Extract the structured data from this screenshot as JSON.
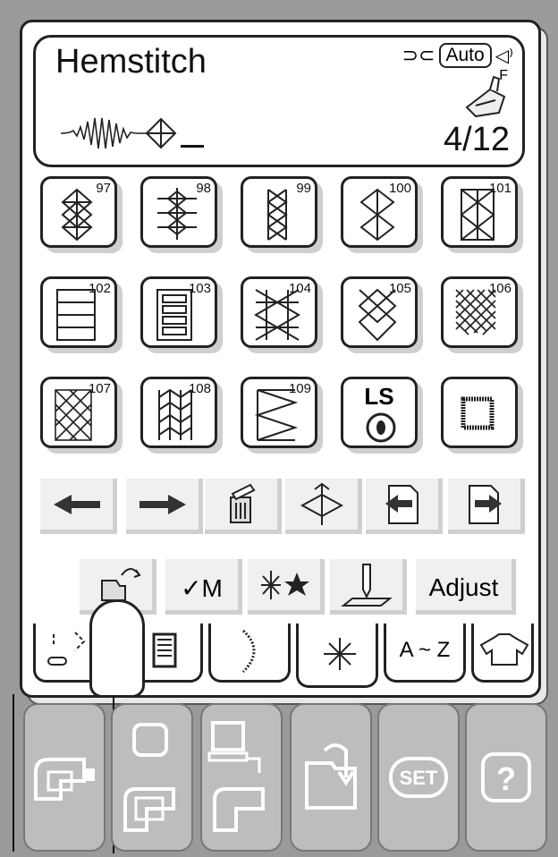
{
  "header": {
    "title": "Hemstitch",
    "auto_label": "Auto",
    "foot_label": "F",
    "page_indicator": "4/12"
  },
  "stitches": [
    {
      "number": "97",
      "pattern": "diamond-stack-3"
    },
    {
      "number": "98",
      "pattern": "zigzag-diamond"
    },
    {
      "number": "99",
      "pattern": "diamond-stack-double"
    },
    {
      "number": "100",
      "pattern": "diamond-stack-large"
    },
    {
      "number": "101",
      "pattern": "box-diamond"
    },
    {
      "number": "102",
      "pattern": "box-ladder"
    },
    {
      "number": "103",
      "pattern": "box-ladder-double"
    },
    {
      "number": "104",
      "pattern": "cross-lattice"
    },
    {
      "number": "105",
      "pattern": "diamond-chain"
    },
    {
      "number": "106",
      "pattern": "dense-lattice"
    },
    {
      "number": "107",
      "pattern": "box-lattice"
    },
    {
      "number": "108",
      "pattern": "feather"
    },
    {
      "number": "109",
      "pattern": "zigzag-box"
    },
    {
      "number": "",
      "pattern": "ls-button"
    },
    {
      "number": "",
      "pattern": "square-outline"
    }
  ],
  "ls_label": "LS",
  "row_labels": {
    "memory": "✓M",
    "adjust": "Adjust"
  },
  "tab_labels": {
    "alphabet": "A ~ Z"
  },
  "icons": {
    "row1": [
      "arrow-left-icon",
      "arrow-right-icon",
      "delete-icon",
      "mirror-icon",
      "insert-left-icon",
      "insert-right-icon"
    ],
    "row2": [
      "image-icon",
      "memory-check-icon",
      "combination-icon",
      "needle-icon",
      "adjust-text"
    ],
    "bottom": [
      "sewing-machine-icon",
      "embroidery-icon",
      "pc-link-icon",
      "folder-icon",
      "set-icon",
      "help-icon"
    ]
  }
}
